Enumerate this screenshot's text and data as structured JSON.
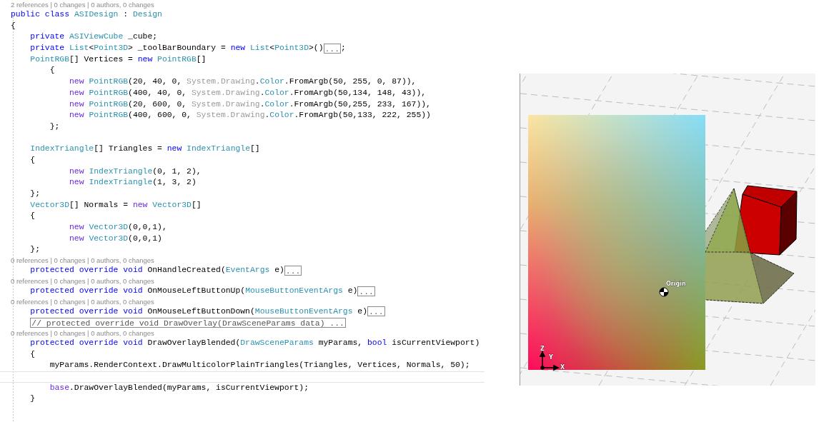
{
  "editor": {
    "lines": [
      {
        "kind": "lens",
        "text": "2 references | 0 changes | 0 authors, 0 changes"
      },
      {
        "kind": "code",
        "tokens": [
          {
            "kind": "kw",
            "text": "public class "
          },
          {
            "kind": "type",
            "text": "ASIDesign"
          },
          {
            "kind": "plain",
            "text": " : "
          },
          {
            "kind": "type",
            "text": "Design"
          }
        ]
      },
      {
        "kind": "code",
        "tokens": [
          {
            "kind": "plain",
            "text": "{"
          }
        ]
      },
      {
        "kind": "code",
        "tokens": [
          {
            "kind": "kw",
            "text": "    private "
          },
          {
            "kind": "type",
            "text": "ASIViewCube"
          },
          {
            "kind": "plain",
            "text": " _cube;"
          }
        ]
      },
      {
        "kind": "code",
        "tokens": [
          {
            "kind": "kw",
            "text": "    private "
          },
          {
            "kind": "type",
            "text": "List"
          },
          {
            "kind": "plain",
            "text": "<"
          },
          {
            "kind": "type",
            "text": "Point3D"
          },
          {
            "kind": "plain",
            "text": "> _toolBarBoundary = "
          },
          {
            "kind": "kw",
            "text": "new "
          },
          {
            "kind": "type",
            "text": "List"
          },
          {
            "kind": "plain",
            "text": "<"
          },
          {
            "kind": "type",
            "text": "Point3D"
          },
          {
            "kind": "plain",
            "text": ">()"
          },
          {
            "kind": "fold",
            "text": "..."
          },
          {
            "kind": "plain",
            "text": ";"
          }
        ]
      },
      {
        "kind": "code",
        "tokens": [
          {
            "kind": "type",
            "text": "    PointRGB"
          },
          {
            "kind": "plain",
            "text": "[] Vertices = "
          },
          {
            "kind": "kw",
            "text": "new "
          },
          {
            "kind": "type",
            "text": "PointRGB"
          },
          {
            "kind": "plain",
            "text": "[]"
          }
        ]
      },
      {
        "kind": "code",
        "tokens": [
          {
            "kind": "plain",
            "text": "        {"
          }
        ]
      },
      {
        "kind": "code",
        "tokens": [
          {
            "kind": "kw2",
            "text": "            new "
          },
          {
            "kind": "type",
            "text": "PointRGB"
          },
          {
            "kind": "plain",
            "text": "(20, 40, 0, "
          },
          {
            "kind": "dim",
            "text": "System.Drawing"
          },
          {
            "kind": "plain",
            "text": "."
          },
          {
            "kind": "type",
            "text": "Color"
          },
          {
            "kind": "plain",
            "text": ".FromArgb(50, 255, 0, 87)),"
          }
        ]
      },
      {
        "kind": "code",
        "tokens": [
          {
            "kind": "kw2",
            "text": "            new "
          },
          {
            "kind": "type",
            "text": "PointRGB"
          },
          {
            "kind": "plain",
            "text": "(400, 40, 0, "
          },
          {
            "kind": "dim",
            "text": "System.Drawing"
          },
          {
            "kind": "plain",
            "text": "."
          },
          {
            "kind": "type",
            "text": "Color"
          },
          {
            "kind": "plain",
            "text": ".FromArgb(50,134, 148, 43)),"
          }
        ]
      },
      {
        "kind": "code",
        "tokens": [
          {
            "kind": "kw2",
            "text": "            new "
          },
          {
            "kind": "type",
            "text": "PointRGB"
          },
          {
            "kind": "plain",
            "text": "(20, 600, 0, "
          },
          {
            "kind": "dim",
            "text": "System.Drawing"
          },
          {
            "kind": "plain",
            "text": "."
          },
          {
            "kind": "type",
            "text": "Color"
          },
          {
            "kind": "plain",
            "text": ".FromArgb(50,255, 233, 167)),"
          }
        ]
      },
      {
        "kind": "code",
        "tokens": [
          {
            "kind": "kw2",
            "text": "            new "
          },
          {
            "kind": "type",
            "text": "PointRGB"
          },
          {
            "kind": "plain",
            "text": "(400, 600, 0, "
          },
          {
            "kind": "dim",
            "text": "System.Drawing"
          },
          {
            "kind": "plain",
            "text": "."
          },
          {
            "kind": "type",
            "text": "Color"
          },
          {
            "kind": "plain",
            "text": ".FromArgb(50,133, 222, 255))"
          }
        ]
      },
      {
        "kind": "code",
        "tokens": [
          {
            "kind": "plain",
            "text": "        };"
          }
        ]
      },
      {
        "kind": "blank"
      },
      {
        "kind": "code",
        "tokens": [
          {
            "kind": "type",
            "text": "    IndexTriangle"
          },
          {
            "kind": "plain",
            "text": "[] Triangles = "
          },
          {
            "kind": "kw",
            "text": "new "
          },
          {
            "kind": "type",
            "text": "IndexTriangle"
          },
          {
            "kind": "plain",
            "text": "[]"
          }
        ]
      },
      {
        "kind": "code",
        "tokens": [
          {
            "kind": "plain",
            "text": "    {"
          }
        ]
      },
      {
        "kind": "code",
        "tokens": [
          {
            "kind": "kw2",
            "text": "            new "
          },
          {
            "kind": "type",
            "text": "IndexTriangle"
          },
          {
            "kind": "plain",
            "text": "(0, 1, 2),"
          }
        ]
      },
      {
        "kind": "code",
        "tokens": [
          {
            "kind": "kw2",
            "text": "            new "
          },
          {
            "kind": "type",
            "text": "IndexTriangle"
          },
          {
            "kind": "plain",
            "text": "(1, 3, 2)"
          }
        ]
      },
      {
        "kind": "code",
        "tokens": [
          {
            "kind": "plain",
            "text": "    };"
          }
        ]
      },
      {
        "kind": "code",
        "tokens": [
          {
            "kind": "type",
            "text": "    Vector3D"
          },
          {
            "kind": "plain",
            "text": "[] Normals = "
          },
          {
            "kind": "kw2",
            "text": "new "
          },
          {
            "kind": "type",
            "text": "Vector3D"
          },
          {
            "kind": "plain",
            "text": "[]"
          }
        ]
      },
      {
        "kind": "code",
        "tokens": [
          {
            "kind": "plain",
            "text": "    {"
          }
        ]
      },
      {
        "kind": "code",
        "tokens": [
          {
            "kind": "kw2",
            "text": "            new "
          },
          {
            "kind": "type",
            "text": "Vector3D"
          },
          {
            "kind": "plain",
            "text": "(0,0,1),"
          }
        ]
      },
      {
        "kind": "code",
        "tokens": [
          {
            "kind": "kw2",
            "text": "            new "
          },
          {
            "kind": "type",
            "text": "Vector3D"
          },
          {
            "kind": "plain",
            "text": "(0,0,1)"
          }
        ]
      },
      {
        "kind": "code",
        "tokens": [
          {
            "kind": "plain",
            "text": "    };"
          }
        ]
      },
      {
        "kind": "lens",
        "text": "0 references | 0 changes | 0 authors, 0 changes"
      },
      {
        "kind": "code",
        "tokens": [
          {
            "kind": "kw",
            "text": "    protected override void "
          },
          {
            "kind": "plain",
            "text": "OnHandleCreated("
          },
          {
            "kind": "type",
            "text": "EventArgs"
          },
          {
            "kind": "plain",
            "text": " e)"
          },
          {
            "kind": "fold",
            "text": "..."
          }
        ]
      },
      {
        "kind": "lens",
        "text": "0 references | 0 changes | 0 authors, 0 changes"
      },
      {
        "kind": "code",
        "tokens": [
          {
            "kind": "kw",
            "text": "    protected override void "
          },
          {
            "kind": "plain",
            "text": "OnMouseLeftButtonUp("
          },
          {
            "kind": "type",
            "text": "MouseButtonEventArgs"
          },
          {
            "kind": "plain",
            "text": " e)"
          },
          {
            "kind": "fold",
            "text": "..."
          }
        ]
      },
      {
        "kind": "lens",
        "text": "0 references | 0 changes | 0 authors, 0 changes"
      },
      {
        "kind": "code",
        "tokens": [
          {
            "kind": "kw",
            "text": "    protected override void "
          },
          {
            "kind": "plain",
            "text": "OnMouseLeftButtonDown("
          },
          {
            "kind": "type",
            "text": "MouseButtonEventArgs"
          },
          {
            "kind": "plain",
            "text": " e)"
          },
          {
            "kind": "fold",
            "text": "..."
          }
        ]
      },
      {
        "kind": "code",
        "tokens": [
          {
            "kind": "fold",
            "text": "    // protected override void DrawOverlay(DrawSceneParams data) ..."
          }
        ]
      },
      {
        "kind": "lens",
        "text": "0 references | 0 changes | 0 authors, 0 changes"
      },
      {
        "kind": "code",
        "tokens": [
          {
            "kind": "kw",
            "text": "    protected override void "
          },
          {
            "kind": "plain",
            "text": "DrawOverlayBlended("
          },
          {
            "kind": "type",
            "text": "DrawSceneParams"
          },
          {
            "kind": "plain",
            "text": " myParams, "
          },
          {
            "kind": "kw",
            "text": "bool "
          },
          {
            "kind": "plain",
            "text": "isCurrentViewport)"
          }
        ]
      },
      {
        "kind": "code",
        "tokens": [
          {
            "kind": "plain",
            "text": "    {"
          }
        ]
      },
      {
        "kind": "code",
        "tokens": [
          {
            "kind": "plain",
            "text": "        myParams.RenderContext.DrawMulticolorPlainTriangles(Triangles, Vertices, Normals, 50);"
          }
        ]
      },
      {
        "kind": "current"
      },
      {
        "kind": "code",
        "tokens": [
          {
            "kind": "kw2",
            "text": "        base"
          },
          {
            "kind": "plain",
            "text": ".DrawOverlayBlended(myParams, isCurrentViewport);"
          }
        ]
      },
      {
        "kind": "code",
        "tokens": [
          {
            "kind": "plain",
            "text": "    }"
          }
        ]
      }
    ]
  },
  "viewport": {
    "origin_label": "Origin",
    "axes": [
      "Z",
      "Y",
      "X"
    ]
  }
}
